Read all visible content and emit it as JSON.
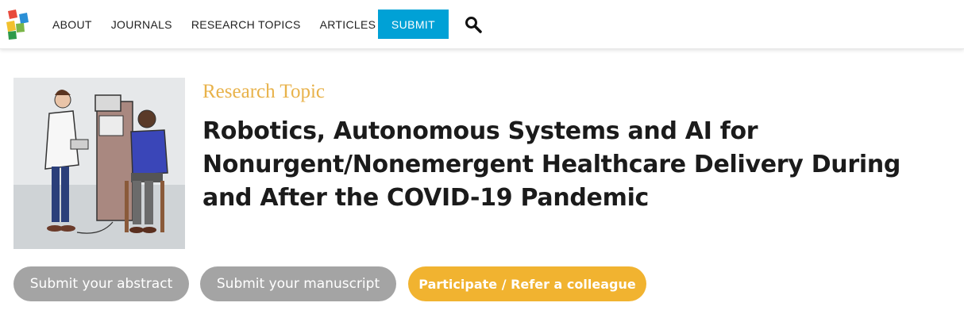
{
  "header": {
    "logo_icon": "frontiers-logo-icon",
    "nav": [
      "ABOUT",
      "JOURNALS",
      "RESEARCH TOPICS",
      "ARTICLES"
    ],
    "submit_label": "SUBMIT",
    "search_icon": "search-icon",
    "accent_color": "#00a1d6"
  },
  "topic": {
    "label": "Research Topic",
    "title": "Robotics, Autonomous Systems and AI for Nonurgent/Nonemergent Healthcare Delivery During and After the COVID-19 Pandemic",
    "image_icon": "telehealth-illustration",
    "label_color": "#e8b24a"
  },
  "actions": {
    "abstract": "Submit your abstract",
    "manuscript": "Submit your manuscript",
    "participate": "Participate / Refer a colleague",
    "secondary_color": "#a4a4a4",
    "primary_color": "#f1b330"
  }
}
